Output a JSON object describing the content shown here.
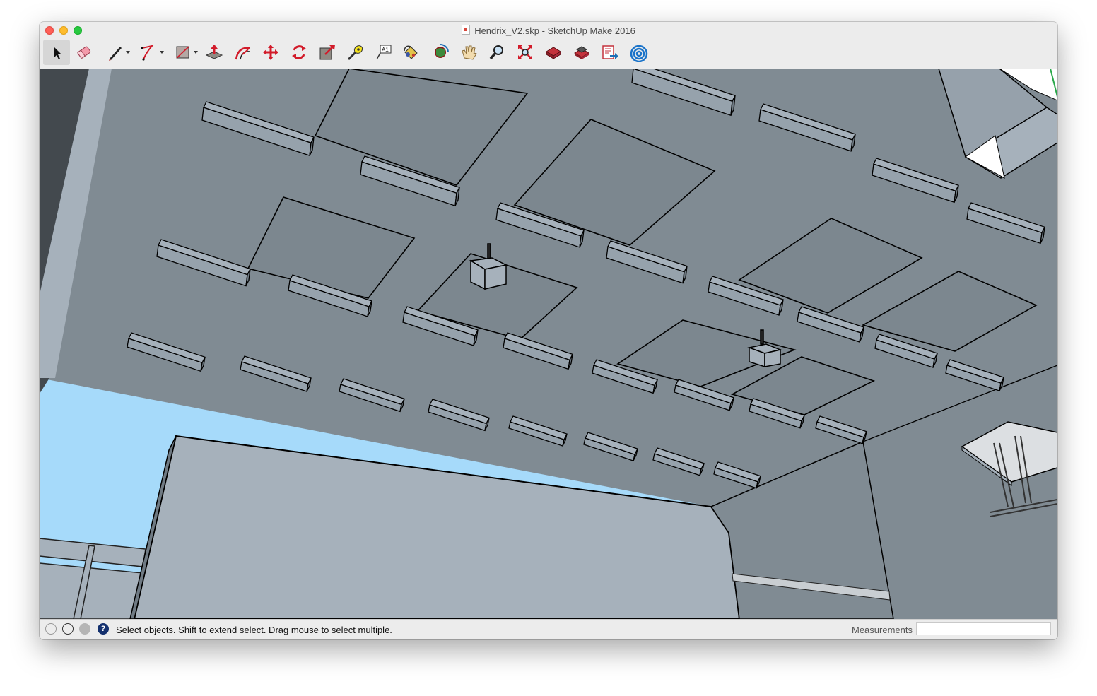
{
  "window": {
    "title": "Hendrix_V2.skp - SketchUp Make 2016"
  },
  "toolbar": {
    "tools": [
      {
        "name": "select-tool",
        "icon": "arrow-cursor-icon"
      },
      {
        "name": "eraser-tool",
        "icon": "eraser-icon"
      },
      {
        "name": "line-tool",
        "icon": "pencil-icon"
      },
      {
        "name": "arc-tool",
        "icon": "arc-icon"
      },
      {
        "name": "rectangle-tool",
        "icon": "rectangle-icon"
      },
      {
        "name": "push-pull-tool",
        "icon": "push-pull-icon"
      },
      {
        "name": "offset-tool",
        "icon": "offset-icon"
      },
      {
        "name": "move-tool",
        "icon": "move-arrows-icon"
      },
      {
        "name": "rotate-tool",
        "icon": "rotate-icon"
      },
      {
        "name": "scale-tool",
        "icon": "scale-icon"
      },
      {
        "name": "tape-measure-tool",
        "icon": "tape-measure-icon"
      },
      {
        "name": "text-tool",
        "icon": "text-label-icon",
        "label": "A1"
      },
      {
        "name": "paint-bucket-tool",
        "icon": "paint-bucket-icon"
      },
      {
        "name": "orbit-tool",
        "icon": "orbit-icon"
      },
      {
        "name": "pan-tool",
        "icon": "hand-icon"
      },
      {
        "name": "zoom-tool",
        "icon": "magnifier-icon"
      },
      {
        "name": "zoom-extents-tool",
        "icon": "zoom-extents-icon"
      },
      {
        "name": "3d-warehouse-tool",
        "icon": "warehouse-icon"
      },
      {
        "name": "extension-warehouse-tool",
        "icon": "extension-warehouse-icon"
      },
      {
        "name": "send-to-layout-tool",
        "icon": "layout-icon"
      },
      {
        "name": "trimble-connect-tool",
        "icon": "connect-icon"
      }
    ],
    "active_tool": "select-tool"
  },
  "status": {
    "message": "Select objects. Shift to extend select. Drag mouse to select multiple.",
    "measurements_label": "Measurements",
    "measurements_value": ""
  },
  "colors": {
    "ceiling": "#808b93",
    "sky": "#a6dafa",
    "light_face": "#a6b1bb",
    "dark_wall": "#43494e",
    "edge": "#000000"
  }
}
